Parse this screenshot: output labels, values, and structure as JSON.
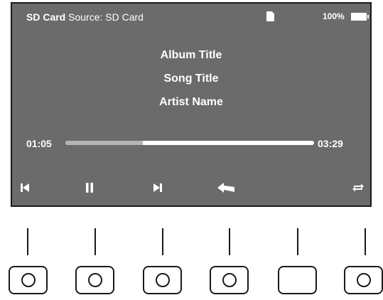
{
  "status": {
    "brand": "SD Card",
    "source_text": "Source: SD Card",
    "battery_text": "100%"
  },
  "track": {
    "album": "Album Title",
    "song": "Song Title",
    "artist": "Artist Name"
  },
  "progress": {
    "elapsed": "01:05",
    "total": "03:29",
    "fraction": 0.31
  },
  "controls": [
    {
      "icon": "skip-previous-icon"
    },
    {
      "icon": "pause-icon"
    },
    {
      "icon": "skip-next-icon"
    },
    {
      "icon": "back-icon"
    },
    {
      "icon": "repeat-icon"
    }
  ],
  "hardware_buttons": [
    {
      "name": "hardware-button-1",
      "has_ring": true
    },
    {
      "name": "hardware-button-2",
      "has_ring": true
    },
    {
      "name": "hardware-button-3",
      "has_ring": true
    },
    {
      "name": "hardware-button-4",
      "has_ring": true
    },
    {
      "name": "hardware-button-5",
      "has_ring": false
    },
    {
      "name": "hardware-button-6",
      "has_ring": true
    }
  ]
}
